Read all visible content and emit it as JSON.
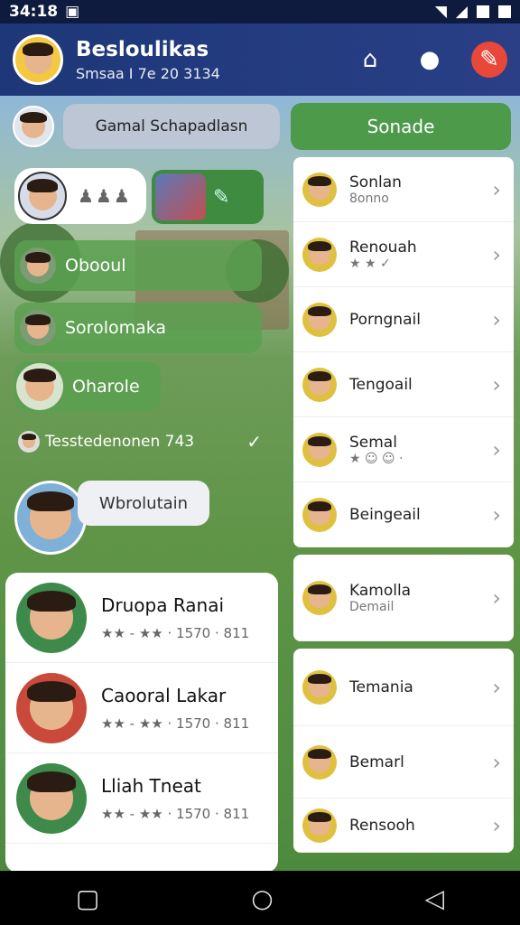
{
  "status_bar": {
    "time": "34:18"
  },
  "header": {
    "title": "Besloulikas",
    "subtitle": "Smsaa I 7e 20 3134"
  },
  "search_pill": "Gamal Schapadlasn",
  "green_button": "Sonade",
  "chat_pills": [
    {
      "label": "Obooul"
    },
    {
      "label": "Sorolomaka"
    },
    {
      "label": "Oharole"
    }
  ],
  "meta_row_text": "Tesstedenonen 743",
  "bubble_text": "Wbrolutain",
  "contacts": [
    {
      "name": "Druopa Ranai",
      "meta": "★★ - ★★ · 1570 · 811"
    },
    {
      "name": "Caooral Lakar",
      "meta": "★★ - ★★ · 1570 · 811"
    },
    {
      "name": "Lliah Tneat",
      "meta": "★★ - ★★ · 1570 · 811"
    }
  ],
  "right_list": [
    {
      "name": "Sonlan",
      "status": "8onno"
    },
    {
      "name": "Renouah",
      "status": "★ ★ ✓"
    },
    {
      "name": "Porngnail",
      "status": ""
    },
    {
      "name": "Tengoail",
      "status": ""
    },
    {
      "name": "Semal",
      "status": "★ ☺ ☺ ·"
    },
    {
      "name": "Beingeail",
      "status": ""
    },
    {
      "name": "Kamolla",
      "status": "Demail"
    },
    {
      "name": "Temania",
      "status": ""
    },
    {
      "name": "Bemarl",
      "status": ""
    },
    {
      "name": "Rensooh",
      "status": ""
    }
  ]
}
